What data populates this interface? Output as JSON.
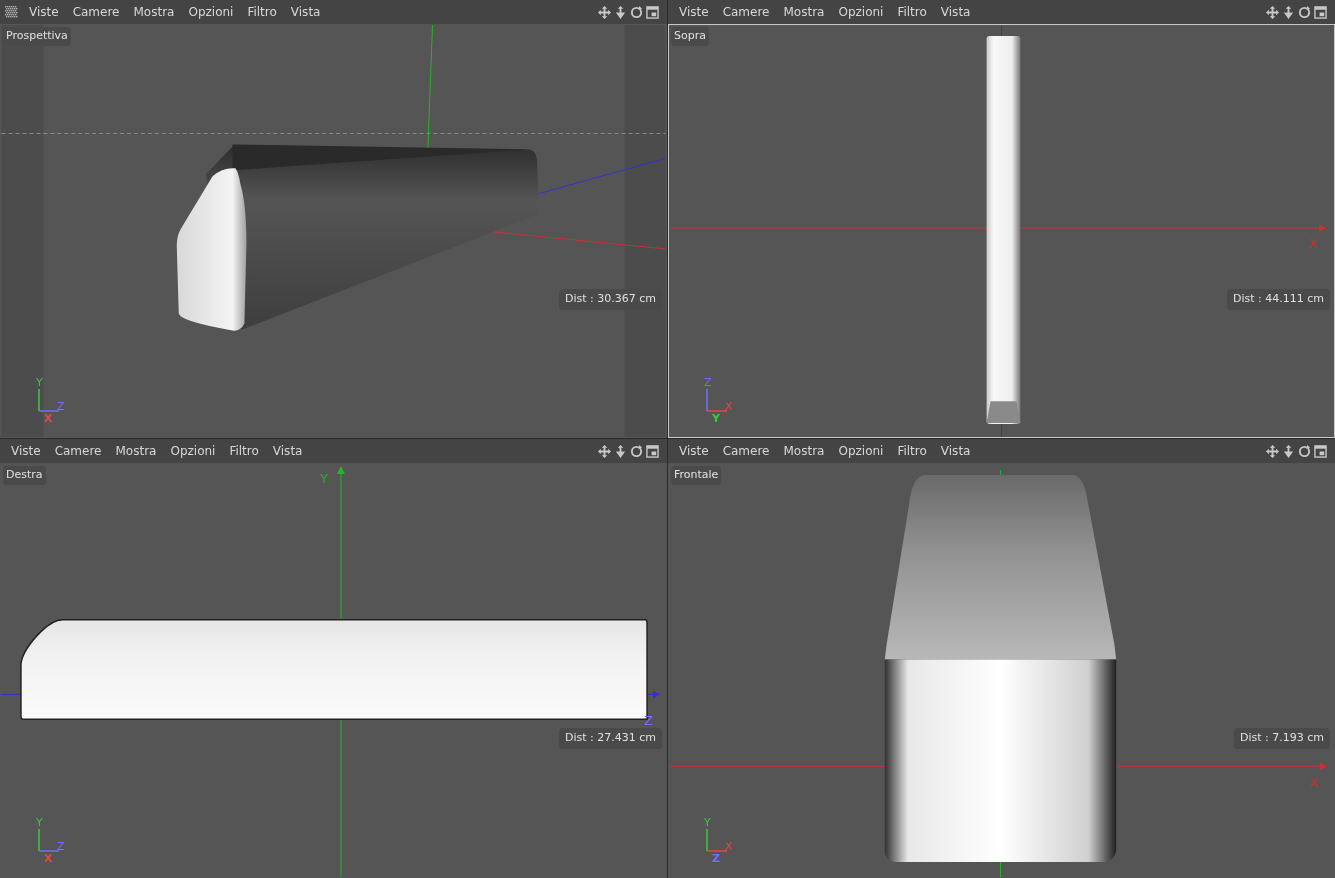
{
  "viewports": [
    {
      "name": "Prospettiva",
      "kind": "perspective",
      "selected": false,
      "menu": [
        "Viste",
        "Camere",
        "Mostra",
        "Opzioni",
        "Filtro",
        "Vista"
      ],
      "dist": "Dist : 30.367 cm",
      "gizmo": [
        {
          "label": "Y",
          "color": "#3cc83c"
        },
        {
          "label": "Z",
          "color": "#7070ff"
        },
        {
          "label": "X",
          "color": "#e04848"
        }
      ]
    },
    {
      "name": "Sopra",
      "kind": "top",
      "selected": true,
      "menu": [
        "Viste",
        "Camere",
        "Mostra",
        "Opzioni",
        "Filtro",
        "Vista"
      ],
      "dist": "Dist : 44.111 cm",
      "axis_labels": [
        "X"
      ],
      "gizmo": [
        {
          "label": "Z",
          "color": "#7070ff"
        },
        {
          "label": "X",
          "color": "#e04848"
        },
        {
          "label": "Y",
          "color": "#3cc83c"
        }
      ]
    },
    {
      "name": "Destra",
      "kind": "right",
      "selected": false,
      "menu": [
        "Viste",
        "Camere",
        "Mostra",
        "Opzioni",
        "Filtro",
        "Vista"
      ],
      "dist": "Dist : 27.431 cm",
      "axis_labels": [
        "Y",
        "Z"
      ],
      "gizmo": [
        {
          "label": "Y",
          "color": "#3cc83c"
        },
        {
          "label": "Z",
          "color": "#7070ff"
        },
        {
          "label": "X",
          "color": "#e04848"
        }
      ]
    },
    {
      "name": "Frontale",
      "kind": "front",
      "selected": false,
      "menu": [
        "Viste",
        "Camere",
        "Mostra",
        "Opzioni",
        "Filtro",
        "Vista"
      ],
      "dist": "Dist : 7.193 cm",
      "axis_labels": [
        "X"
      ],
      "gizmo": [
        {
          "label": "Y",
          "color": "#3cc83c"
        },
        {
          "label": "X",
          "color": "#e04848"
        },
        {
          "label": "Z",
          "color": "#7070ff"
        }
      ]
    }
  ]
}
